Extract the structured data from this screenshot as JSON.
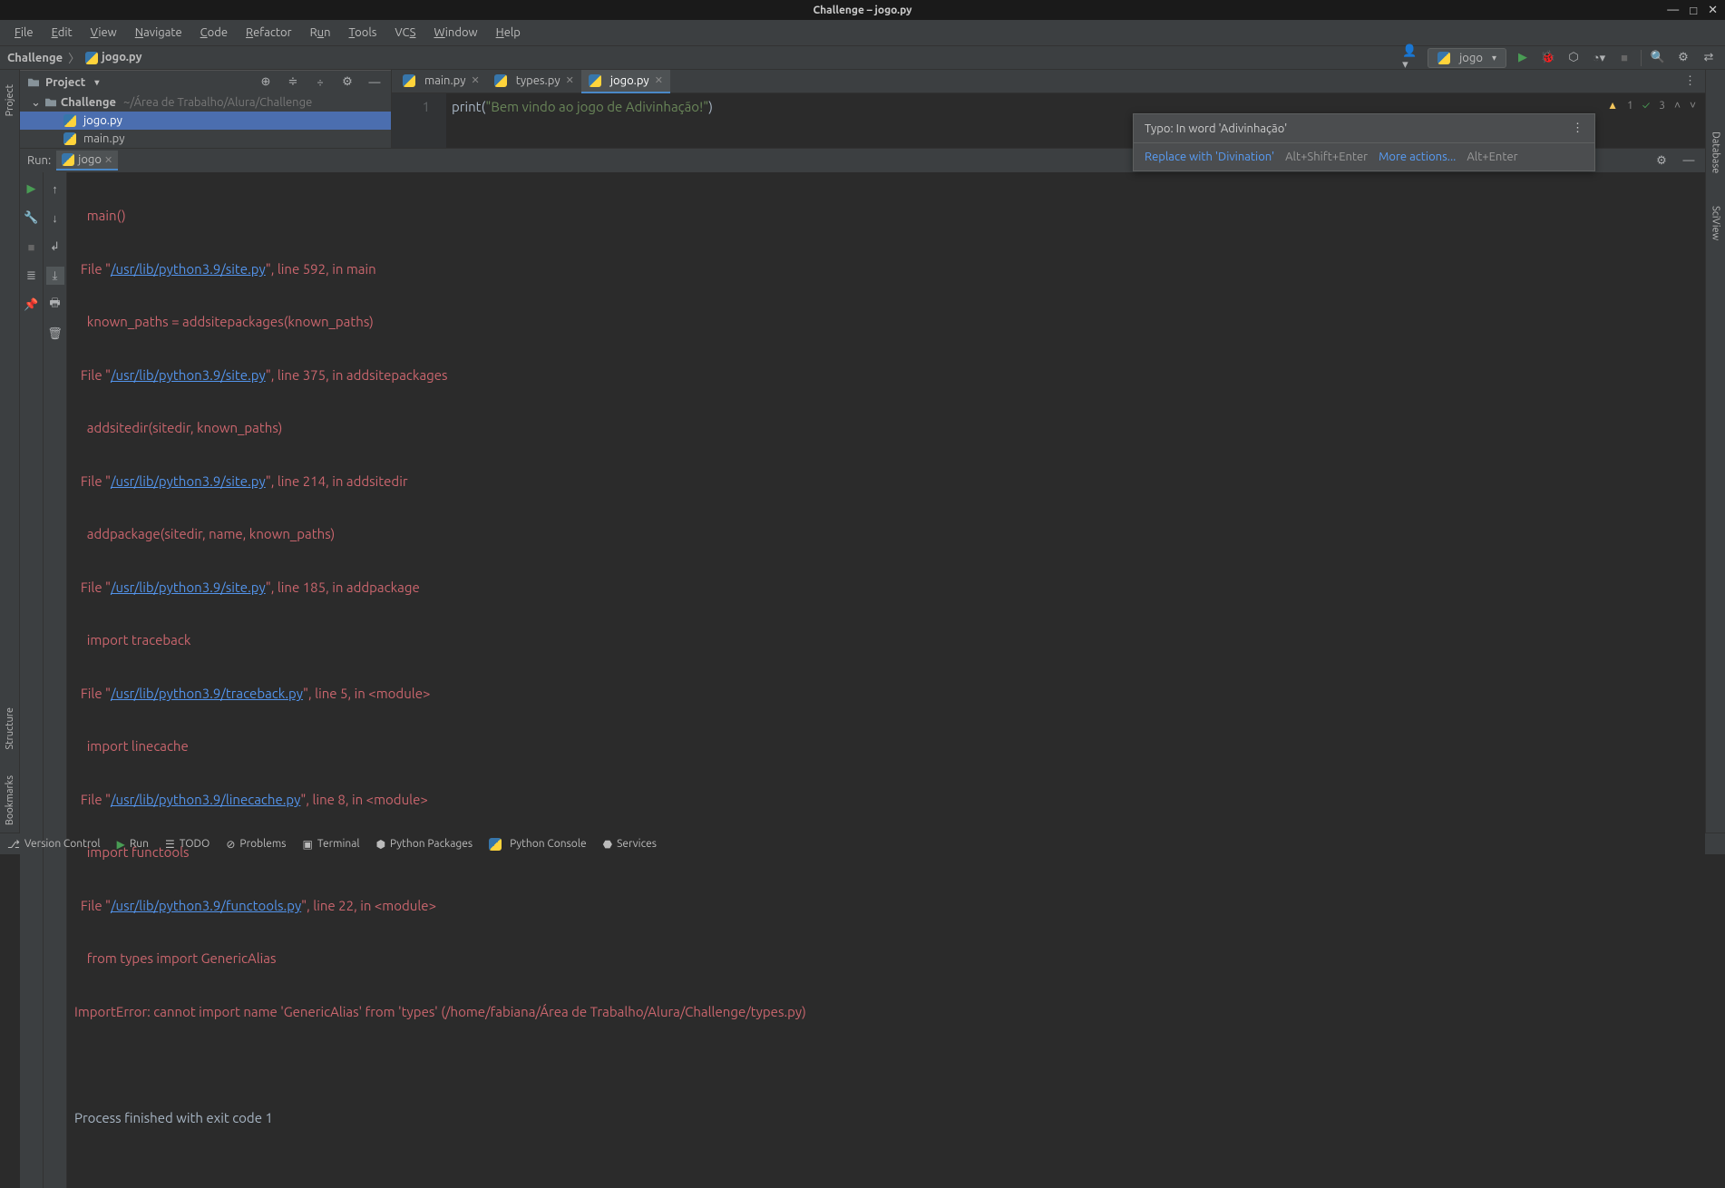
{
  "titlebar": {
    "text": "Challenge – jogo.py"
  },
  "menubar": [
    "File",
    "Edit",
    "View",
    "Navigate",
    "Code",
    "Refactor",
    "Run",
    "Tools",
    "VCS",
    "Window",
    "Help"
  ],
  "breadcrumb": {
    "project": "Challenge",
    "file": "jogo.py"
  },
  "run_config": {
    "label": "jogo"
  },
  "project_panel": {
    "title": "Project",
    "root": "Challenge",
    "root_path": "~/Área de Trabalho/Alura/Challenge",
    "files": [
      "jogo.py",
      "main.py"
    ]
  },
  "editor_tabs": [
    {
      "name": "main.py",
      "active": false
    },
    {
      "name": "types.py",
      "active": false
    },
    {
      "name": "jogo.py",
      "active": true
    }
  ],
  "editor": {
    "line_num": "1",
    "code_prefix": "print",
    "code_open": "(",
    "str_q1": "\"",
    "str_p1": "Bem ",
    "str_w1": "vindo",
    "str_p2": " ao ",
    "str_w2": "jogo",
    "str_p3": " de ",
    "str_w3": "Adivinhação",
    "str_p4": "!",
    "str_q2": "\"",
    "code_close": ")"
  },
  "editor_status": {
    "warn": "1",
    "check": "3"
  },
  "tooltip": {
    "title": "Typo: In word 'Adivinhação'",
    "replace": "Replace with 'Divination'",
    "replace_shortcut": "Alt+Shift+Enter",
    "more": "More actions...",
    "more_shortcut": "Alt+Enter"
  },
  "run_panel": {
    "label": "Run:",
    "tab": "jogo"
  },
  "output": {
    "l1": "    main()",
    "l2a": "  File \"",
    "l2b": "/usr/lib/python3.9/site.py",
    "l2c": "\", line 592, in main",
    "l3": "    known_paths = addsitepackages(known_paths)",
    "l4a": "  File \"",
    "l4b": "/usr/lib/python3.9/site.py",
    "l4c": "\", line 375, in addsitepackages",
    "l5": "    addsitedir(sitedir, known_paths)",
    "l6a": "  File \"",
    "l6b": "/usr/lib/python3.9/site.py",
    "l6c": "\", line 214, in addsitedir",
    "l7": "    addpackage(sitedir, name, known_paths)",
    "l8a": "  File \"",
    "l8b": "/usr/lib/python3.9/site.py",
    "l8c": "\", line 185, in addpackage",
    "l9": "    import traceback",
    "l10a": "  File \"",
    "l10b": "/usr/lib/python3.9/traceback.py",
    "l10c": "\", line 5, in <module>",
    "l11": "    import linecache",
    "l12a": "  File \"",
    "l12b": "/usr/lib/python3.9/linecache.py",
    "l12c": "\", line 8, in <module>",
    "l13": "    import functools",
    "l14a": "  File \"",
    "l14b": "/usr/lib/python3.9/functools.py",
    "l14c": "\", line 22, in <module>",
    "l15": "    from types import GenericAlias",
    "l16": "ImportError: cannot import name 'GenericAlias' from 'types' (/home/fabiana/Área de Trabalho/Alura/Challenge/types.py)",
    "l17": "",
    "l18": "Process finished with exit code 1"
  },
  "statusbar": {
    "items": [
      "Version Control",
      "Run",
      "TODO",
      "Problems",
      "Terminal",
      "Python Packages",
      "Python Console",
      "Services"
    ]
  },
  "left_gutter": [
    "Project"
  ],
  "left_gutter_bottom": [
    "Structure",
    "Bookmarks"
  ],
  "right_gutter": [
    "Database",
    "SciView"
  ]
}
